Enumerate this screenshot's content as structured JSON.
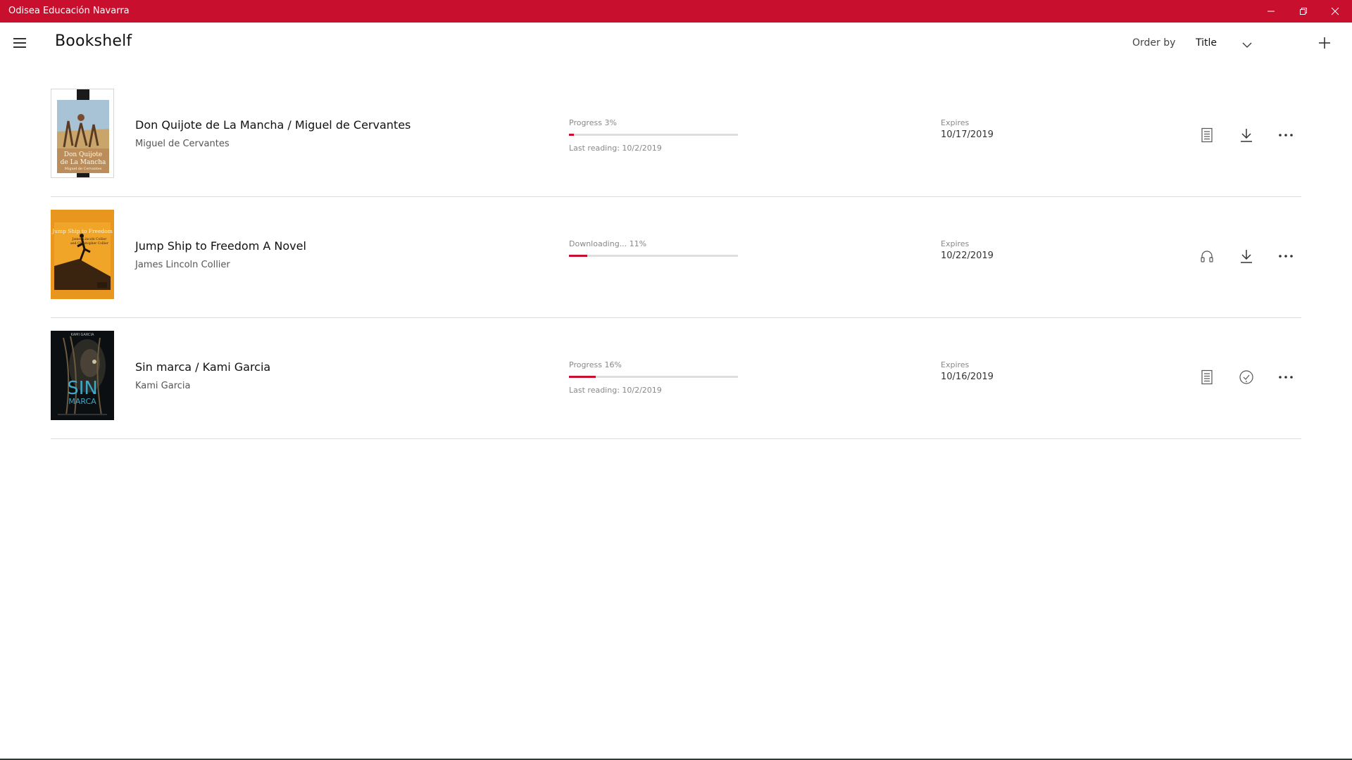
{
  "window": {
    "title": "Odisea Educación Navarra",
    "controls": [
      "minimize-icon",
      "restore-icon",
      "close-icon"
    ],
    "accent_color": "#c8102e"
  },
  "header": {
    "page_title": "Bookshelf",
    "order_by_label": "Order by",
    "order_by_value": "Title",
    "menu_icon": "hamburger-icon",
    "add_icon": "plus-icon"
  },
  "books": [
    {
      "title": "Don Quijote de La Mancha  / Miguel de Cervantes",
      "author": "Miguel de Cervantes",
      "status_label": "Progress 3%",
      "progress_fraction": 0.03,
      "last_reading": "Last reading:  10/2/2019",
      "expires_label": "Expires",
      "expires_date": "10/17/2019",
      "type_icon": "document-icon",
      "action_icon": "download-icon",
      "more_icon": "more-icon",
      "cover": {
        "line1": "Don Quijote",
        "line2": "de La Mancha",
        "line3": "Miguel de Cervantes"
      }
    },
    {
      "title": "Jump Ship to Freedom A Novel",
      "author": "James Lincoln Collier",
      "status_label": "Downloading... 11%",
      "progress_fraction": 0.11,
      "last_reading": "",
      "expires_label": "Expires",
      "expires_date": "10/22/2019",
      "type_icon": "headphones-icon",
      "action_icon": "download-icon",
      "more_icon": "more-icon",
      "cover": {
        "line1": "Jump Ship to Freedom",
        "line2": "James Lincoln Collier",
        "line3": "and Christopher Collier"
      }
    },
    {
      "title": "Sin marca  / Kami Garcia",
      "author": "Kami Garcia",
      "status_label": "Progress 16%",
      "progress_fraction": 0.16,
      "last_reading": "Last reading:  10/2/2019",
      "expires_label": "Expires",
      "expires_date": "10/16/2019",
      "type_icon": "document-icon",
      "action_icon": "downloaded-check-icon",
      "more_icon": "more-icon",
      "cover": {
        "line1": "KAMI GARCIA",
        "line2": "SIN",
        "line3": "MARCA"
      }
    }
  ]
}
